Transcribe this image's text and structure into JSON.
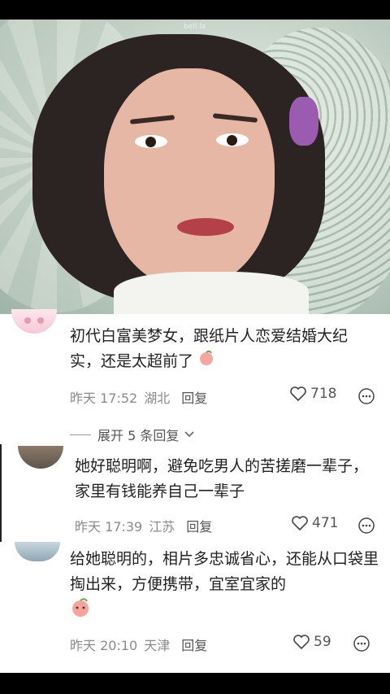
{
  "video": {
    "watermark": "bell.la"
  },
  "comments": [
    {
      "text": "初代白富美梦女，跟纸片人恋爱结婚大纪实，还是太超前了",
      "emoji": "peach-emoji",
      "time": "昨天 17:52",
      "location": "湖北",
      "reply_label": "回复",
      "likes": "718"
    },
    {
      "text": "她好聪明啊，避免吃男人的苦搓磨一辈子，家里有钱能养自己一辈子",
      "time": "昨天 17:39",
      "location": "江苏",
      "reply_label": "回复",
      "likes": "471"
    },
    {
      "text": "给她聪明的，相片多忠诚省心，还能从口袋里掏出来，方便携带，宜室宜家的",
      "emoji": "peach-emoji",
      "time": "昨天 20:10",
      "location": "天津",
      "reply_label": "回复",
      "likes": "59"
    }
  ],
  "expand_replies": "展开 5 条回复",
  "colors": {
    "text": "#222222",
    "meta": "#8a8a8a",
    "background": "#ffffff",
    "bars": "#000000"
  }
}
